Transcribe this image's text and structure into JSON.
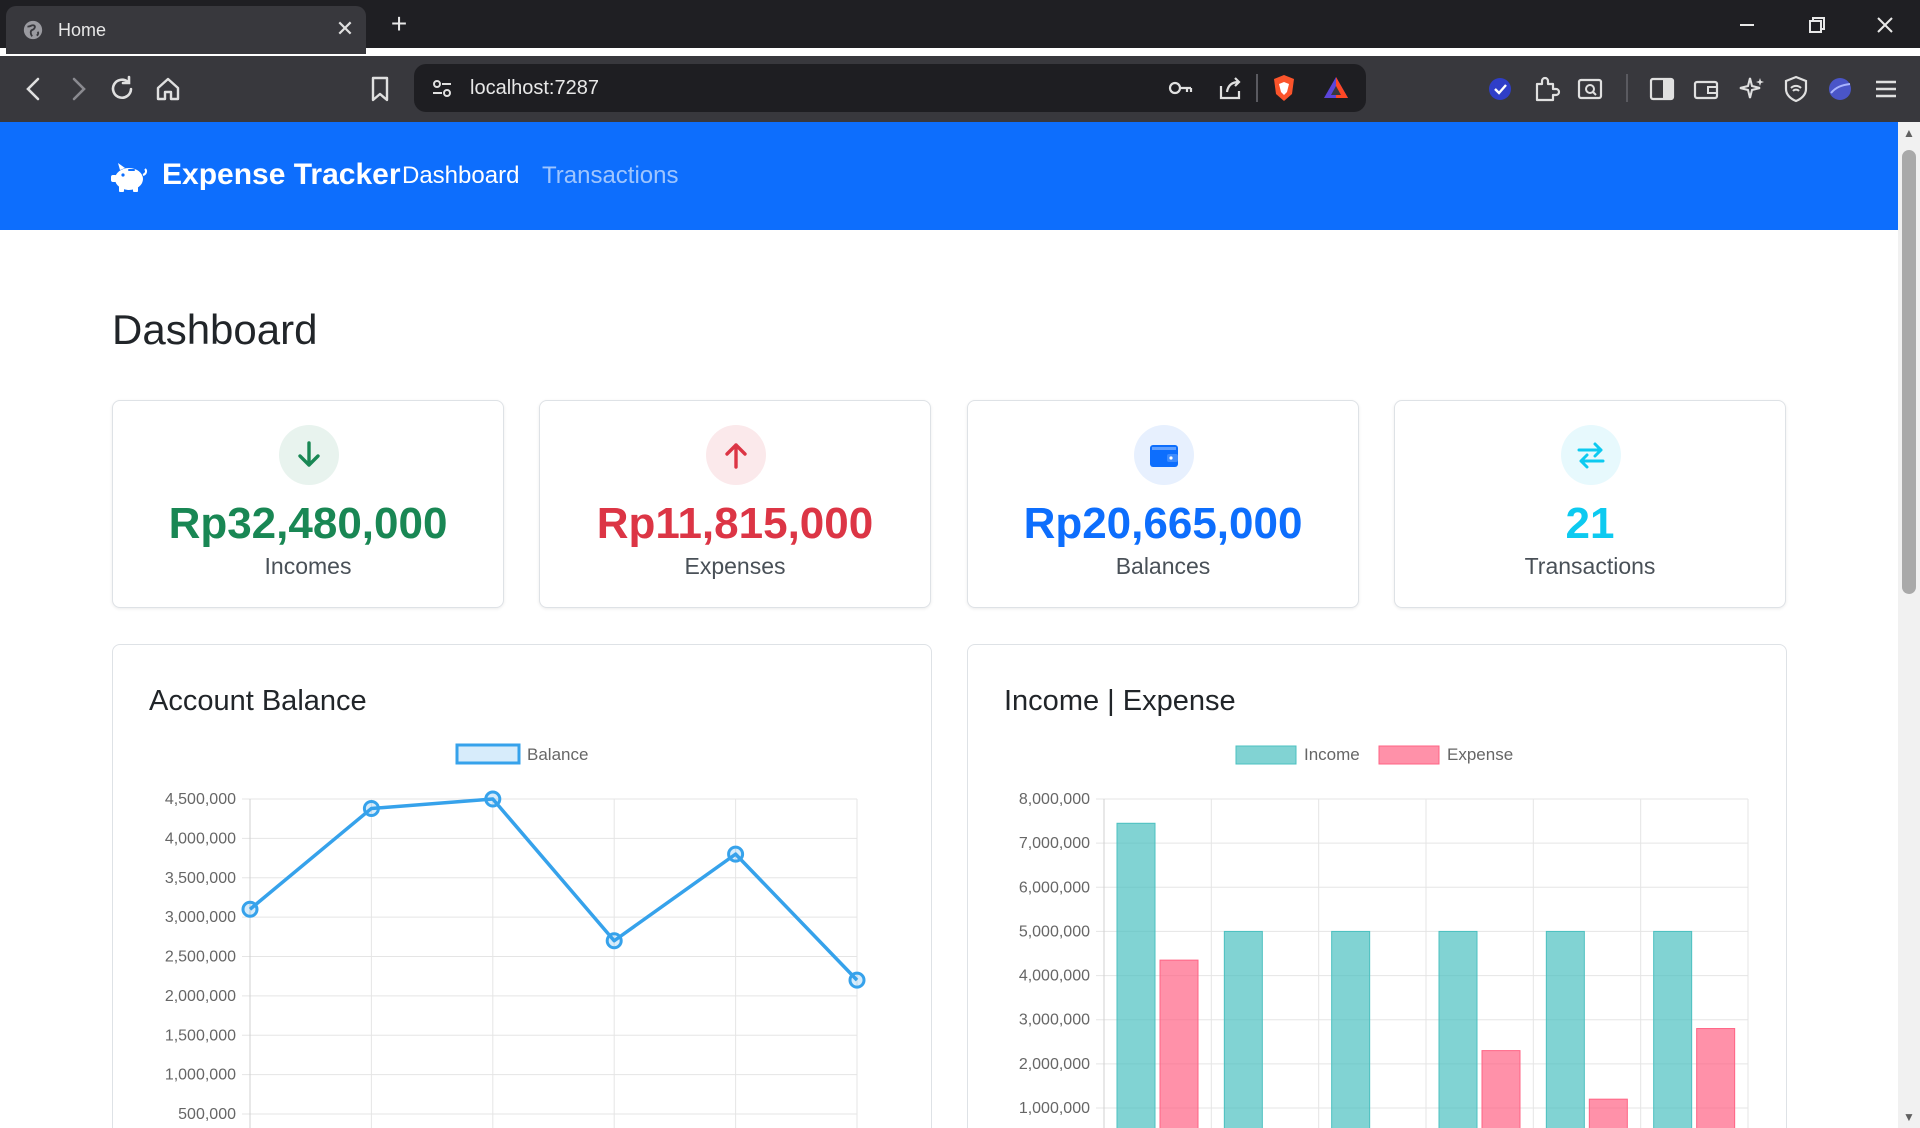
{
  "browser": {
    "tab_title": "Home",
    "address": "localhost:7287"
  },
  "navbar": {
    "brand": "Expense Tracker",
    "links": [
      "Dashboard",
      "Transactions"
    ]
  },
  "page": {
    "title": "Dashboard"
  },
  "stats": [
    {
      "value": "Rp32,480,000",
      "label": "Incomes",
      "color": "#198754",
      "bg": "#e8f3ee",
      "icon": "arrow-down-icon"
    },
    {
      "value": "Rp11,815,000",
      "label": "Expenses",
      "color": "#dc3545",
      "bg": "#fbe9eb",
      "icon": "arrow-up-icon"
    },
    {
      "value": "Rp20,665,000",
      "label": "Balances",
      "color": "#0d6efd",
      "bg": "#e7f0fe",
      "icon": "wallet-icon"
    },
    {
      "value": "21",
      "label": "Transactions",
      "color": "#0dcaf0",
      "bg": "#e7f9fd",
      "icon": "swap-arrows-icon"
    }
  ],
  "charts": {
    "balance_title": "Account Balance",
    "income_expense_title": "Income | Expense"
  },
  "chart_data": [
    {
      "type": "line",
      "title": "Account Balance",
      "series": [
        {
          "name": "Balance",
          "values": [
            3100000,
            4380000,
            4500000,
            2700000,
            3800000,
            2200000
          ]
        }
      ],
      "ylim": [
        0,
        4500000
      ],
      "yticks": [
        "500,000",
        "1,000,000",
        "1,500,000",
        "2,000,000",
        "2,500,000",
        "3,000,000",
        "3,500,000",
        "4,000,000",
        "4,500,000"
      ],
      "grid": true,
      "legend": "top-center",
      "color": "#36a2eb"
    },
    {
      "type": "bar",
      "title": "Income | Expense",
      "series": [
        {
          "name": "Income",
          "values": [
            7450000,
            5000000,
            5000000,
            5000000,
            5000000,
            5000000
          ],
          "color": "#4bc0c0"
        },
        {
          "name": "Expense",
          "values": [
            4350000,
            0,
            0,
            2300000,
            1200000,
            2800000
          ],
          "color": "#ff6384"
        }
      ],
      "ylim": [
        0,
        8000000
      ],
      "yticks": [
        "1,000,000",
        "2,000,000",
        "3,000,000",
        "4,000,000",
        "5,000,000",
        "6,000,000",
        "7,000,000",
        "8,000,000"
      ],
      "grid": true,
      "legend": "top-center"
    }
  ]
}
